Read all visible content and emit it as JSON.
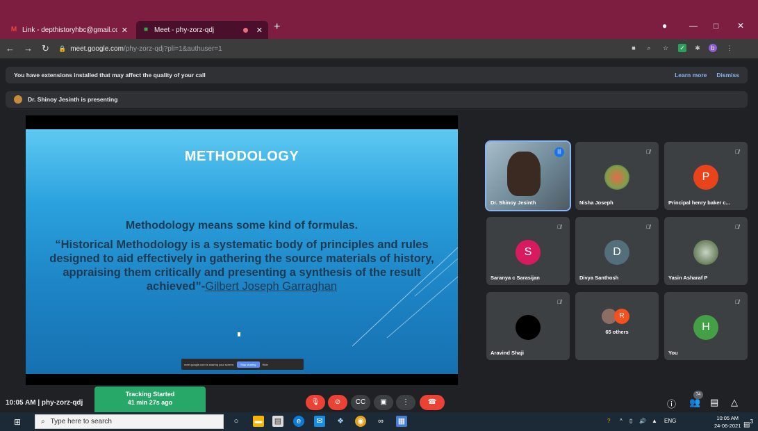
{
  "browser": {
    "tabs": [
      {
        "favicon": "M",
        "title": "Link - depthistoryhbc@gmail.co"
      },
      {
        "title": "Meet - phy-zorz-qdj"
      }
    ],
    "url_host": "meet.google.com",
    "url_path": "/phy-zorz-qdj?pli=1&authuser=1",
    "profile_initial": "b",
    "accent": "#7d1d3f"
  },
  "extension_banner": {
    "text": "You have extensions installed that may affect the quality of your call",
    "learn_more": "Learn more",
    "dismiss": "Dismiss"
  },
  "presenting_banner": {
    "text": "Dr. Shinoy Jesinth is presenting"
  },
  "slide": {
    "title": "METHODOLOGY",
    "line1": "Methodology means some kind of formulas.",
    "body": "“Historical Methodology is a systematic body of principles and rules designed to aid effectively in gathering the source materials of history, appraising them critically and presenting a synthesis of the result achieved”-",
    "author": "Gilbert Joseph Garraghan",
    "share_notice": "meet.google.com is sharing your screen.",
    "stop_sharing": "Stop sharing",
    "hide": "Hide"
  },
  "participants": [
    {
      "name": "Dr. Shinoy Jesinth",
      "kind": "video"
    },
    {
      "name": "Nisha Joseph",
      "kind": "photo"
    },
    {
      "name": "Principal henry baker c...",
      "initial": "P",
      "color": "#e8431a"
    },
    {
      "name": "Saranya c Sarasijan",
      "initial": "S",
      "color": "#d81b60"
    },
    {
      "name": "Divya Santhosh",
      "initial": "D",
      "color": "#546e7a"
    },
    {
      "name": "Yasin Asharaf P",
      "kind": "photo"
    },
    {
      "name": "Aravind Shaji",
      "kind": "black"
    },
    {
      "name": "65 others",
      "initial": "R",
      "color": "#f4511e"
    },
    {
      "name": "You",
      "initial": "H",
      "color": "#43a047"
    }
  ],
  "meet_bar": {
    "time_code": "10:05 AM  |  phy-zorz-qdj",
    "tracking_line1": "Tracking Started",
    "tracking_line2": "41 min 27s ago",
    "people_count": "74"
  },
  "taskbar": {
    "search_placeholder": "Type here to search",
    "language": "ENG",
    "time": "10:05 AM",
    "date": "24-06-2021",
    "notifications": "3"
  }
}
